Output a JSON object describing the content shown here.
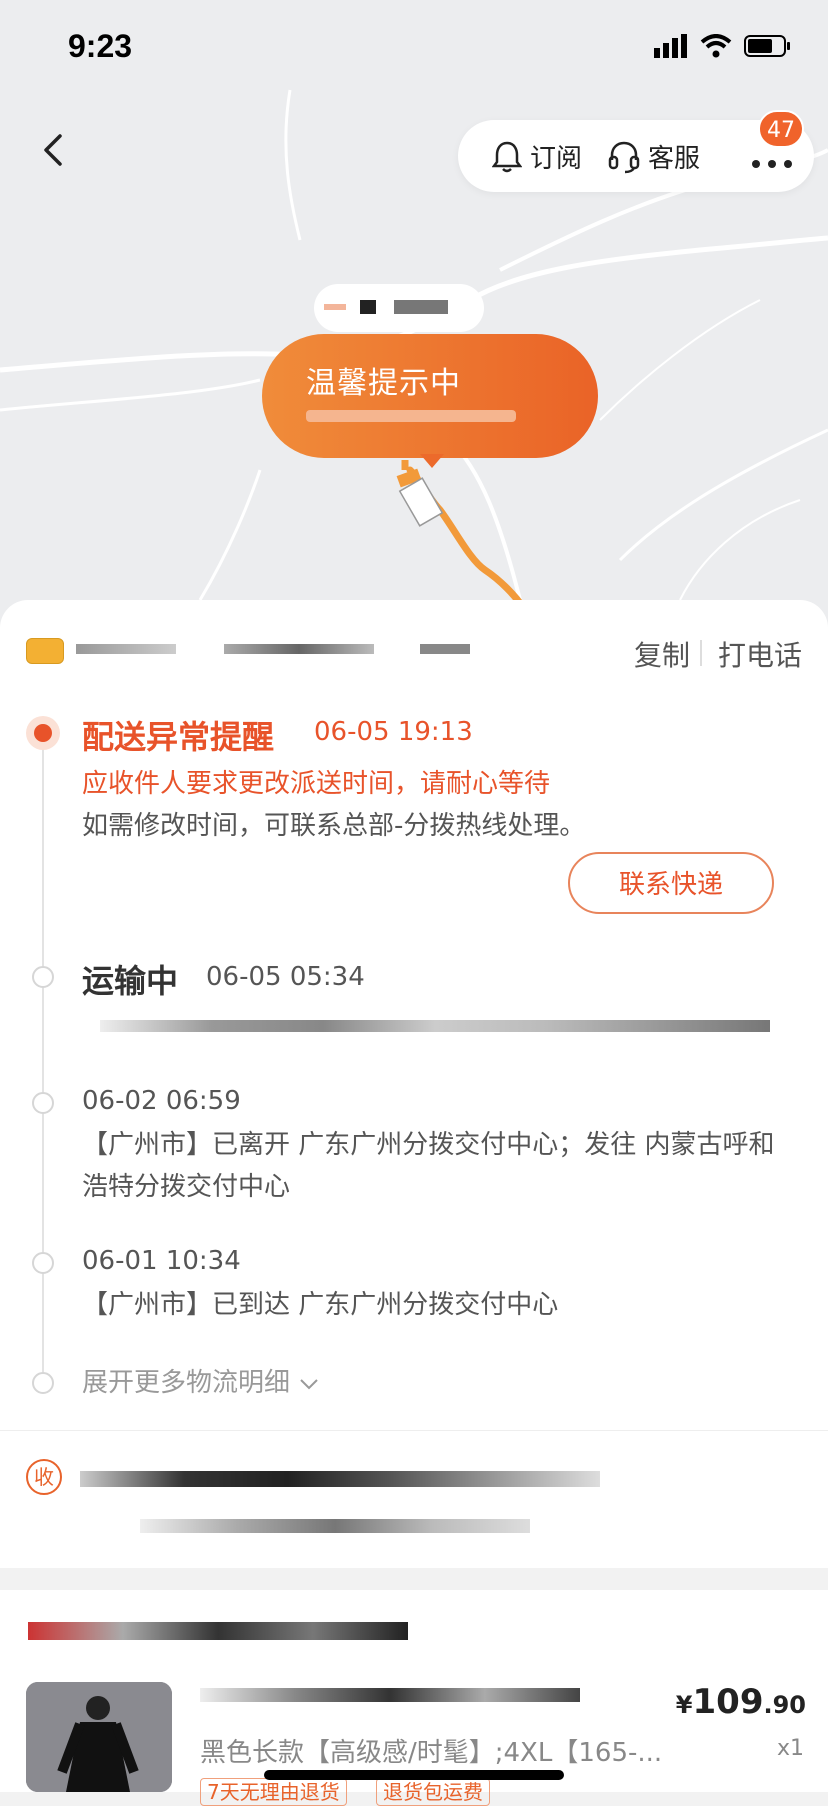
{
  "status_bar": {
    "time": "9:23"
  },
  "header": {
    "subscribe_label": "订阅",
    "service_label": "客服",
    "badge_count": "47"
  },
  "map_bubble": {
    "title": "温馨提示中"
  },
  "courier": {
    "copy_label": "复制",
    "call_label": "打电话"
  },
  "timeline": {
    "events": [
      {
        "title": "配送异常提醒",
        "time": "06-05 19:13",
        "highlight": "应收件人要求更改派送时间，请耐心等待",
        "text": "如需修改时间，可联系总部-分拨热线处理。"
      },
      {
        "title": "运输中",
        "time": "06-05 05:34"
      },
      {
        "time": "06-02 06:59",
        "text": "【广州市】已离开 广东广州分拨交付中心；发往 内蒙古呼和浩特分拨交付中心"
      },
      {
        "time": "06-01 10:34",
        "text": "【广州市】已到达 广东广州分拨交付中心"
      }
    ],
    "contact_button": "联系快递",
    "expand_label": "展开更多物流明细"
  },
  "receiver": {
    "icon_label": "收"
  },
  "product": {
    "price_symbol": "¥",
    "price_int": "109",
    "price_dec": ".90",
    "variant": "黑色长款【高级感/时髦】;4XL【165-...",
    "qty": "x1",
    "tags": [
      "7天无理由退货",
      "退货包运费"
    ]
  },
  "colors": {
    "accent": "#e8532a",
    "bubble_start": "#f08c3a",
    "bubble_end": "#ea6327"
  }
}
